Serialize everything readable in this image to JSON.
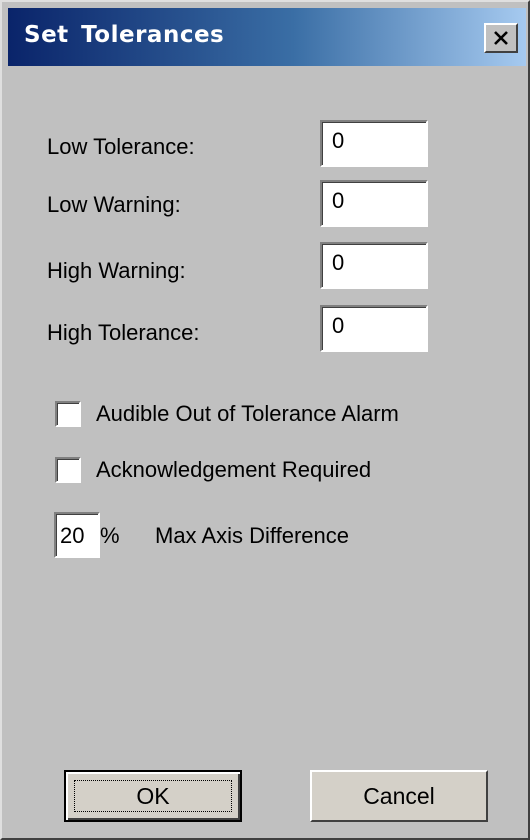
{
  "dialog": {
    "title": "Set  Tolerances",
    "close_icon": "close-icon"
  },
  "fields": [
    {
      "label": "Low Tolerance:",
      "value": "0"
    },
    {
      "label": "Low Warning:",
      "value": "0"
    },
    {
      "label": "High Warning:",
      "value": "0"
    },
    {
      "label": "High Tolerance:",
      "value": "0"
    }
  ],
  "checkboxes": [
    {
      "label": "Audible Out of Tolerance Alarm",
      "checked": false
    },
    {
      "label": "Acknowledgement Required",
      "checked": false
    }
  ],
  "max_axis": {
    "value": "20",
    "unit": "%",
    "label": "Max Axis Difference"
  },
  "buttons": {
    "ok_label": "OK",
    "cancel_label": "Cancel"
  },
  "colors": {
    "title_bar_start": "#0a246a",
    "title_bar_end": "#a6caf0",
    "dialog_face": "#c0c0c0"
  }
}
